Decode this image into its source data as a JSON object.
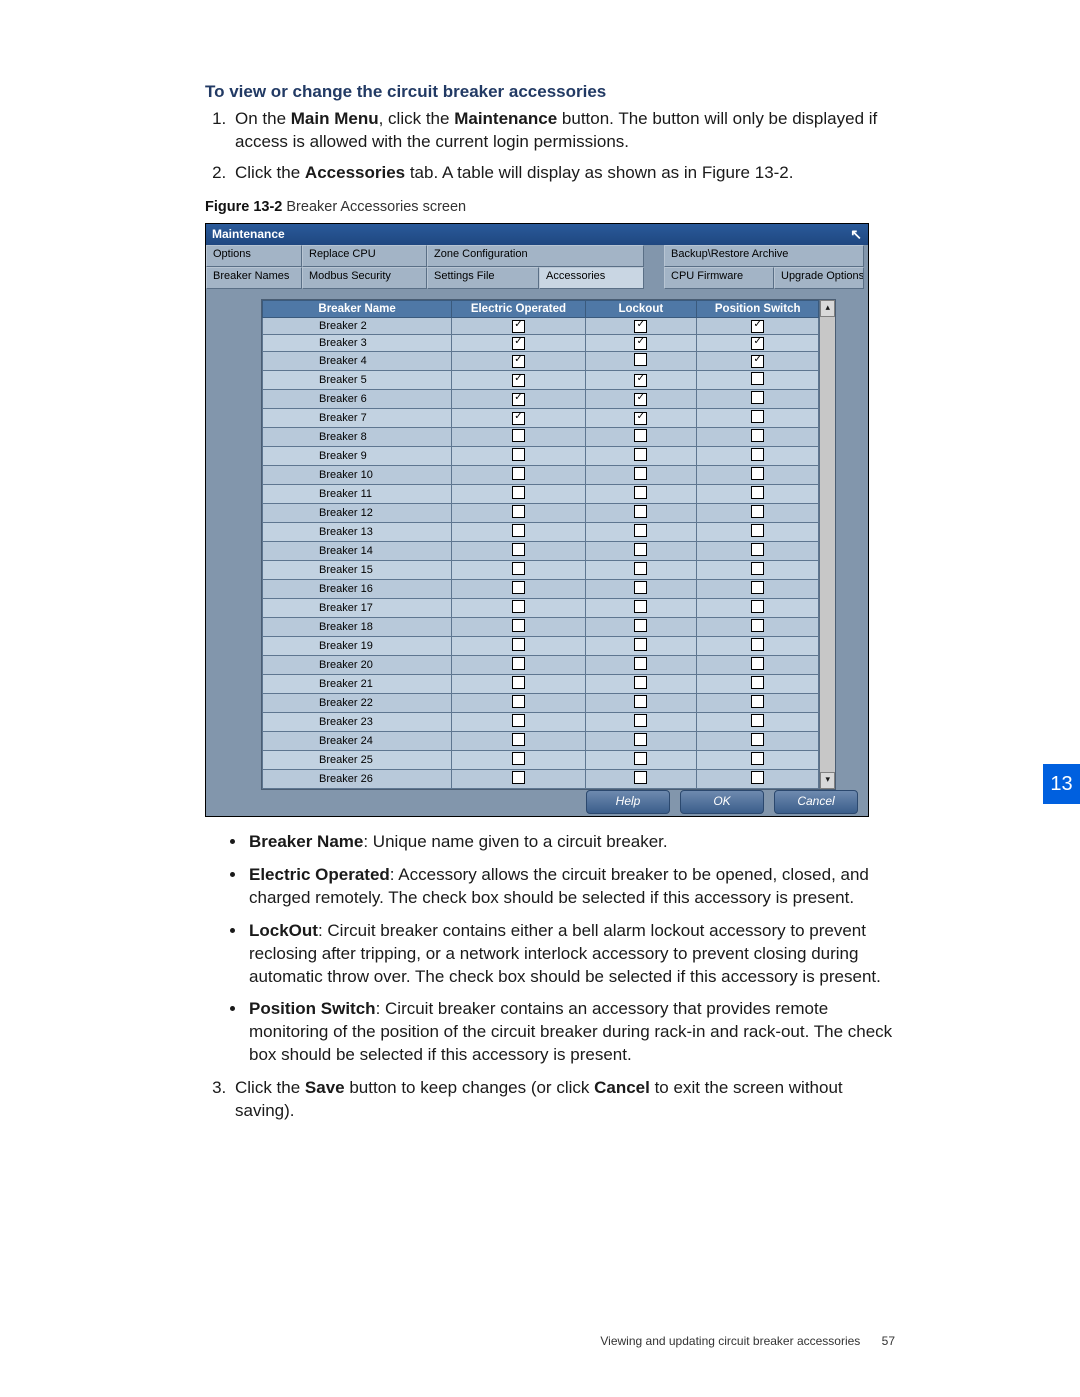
{
  "doc": {
    "heading": "To view or change the circuit breaker accessories",
    "step1_pre": "On the ",
    "step1_b1": "Main Menu",
    "step1_mid": ", click the ",
    "step1_b2": "Maintenance",
    "step1_post": " button. The button will only be displayed if access is allowed with the current login permissions.",
    "step2_pre": "Click the ",
    "step2_b1": "Accessories",
    "step2_post": " tab. A table will display as shown as in Figure 13-2.",
    "fig_label": "Figure 13-2",
    "fig_title": " Breaker Accessories screen",
    "bullet1_b": "Breaker Name",
    "bullet1_t": ": Unique name given to a circuit breaker.",
    "bullet2_b": "Electric Operated",
    "bullet2_t": ": Accessory allows the circuit breaker to be opened, closed, and charged remotely. The check box should be selected if this accessory is present.",
    "bullet3_b": "LockOut",
    "bullet3_t": ": Circuit breaker contains either a bell alarm lockout accessory to prevent reclosing after tripping, or a network interlock accessory to prevent closing during automatic throw over. The check box should be selected if this accessory is present.",
    "bullet4_b": "Position Switch",
    "bullet4_t": ": Circuit breaker contains an accessory that provides remote monitoring of the position of the circuit breaker during rack-in and rack-out. The check box should be selected if this accessory is present.",
    "step3_pre": "Click the ",
    "step3_b1": "Save",
    "step3_mid": " button to keep changes (or click ",
    "step3_b2": "Cancel",
    "step3_post": " to exit the screen without saving).",
    "chapter": "13",
    "footer_text": "Viewing and updating circuit breaker accessories",
    "page_number": "57"
  },
  "window": {
    "title": "Maintenance",
    "tabs_row1": [
      "Options",
      "Replace CPU",
      "Zone Configuration",
      "",
      "Backup\\Restore Archive",
      ""
    ],
    "tabs_row2": [
      "Breaker Names",
      "Modbus Security",
      "Settings File",
      "Accessories",
      "",
      "CPU Firmware",
      "Upgrade Options"
    ],
    "active_tab": "Accessories",
    "headers": [
      "Breaker Name",
      "Electric Operated",
      "Lockout",
      "Position Switch"
    ],
    "rows": [
      {
        "name": "Breaker 2",
        "eo": true,
        "lo": true,
        "ps": true
      },
      {
        "name": "Breaker 3",
        "eo": true,
        "lo": true,
        "ps": true
      },
      {
        "name": "Breaker 4",
        "eo": true,
        "lo": false,
        "ps": true
      },
      {
        "name": "Breaker 5",
        "eo": true,
        "lo": true,
        "ps": false
      },
      {
        "name": "Breaker 6",
        "eo": true,
        "lo": true,
        "ps": false
      },
      {
        "name": "Breaker 7",
        "eo": true,
        "lo": true,
        "ps": false
      },
      {
        "name": "Breaker 8",
        "eo": false,
        "lo": false,
        "ps": false
      },
      {
        "name": "Breaker 9",
        "eo": false,
        "lo": false,
        "ps": false
      },
      {
        "name": "Breaker 10",
        "eo": false,
        "lo": false,
        "ps": false
      },
      {
        "name": "Breaker 11",
        "eo": false,
        "lo": false,
        "ps": false
      },
      {
        "name": "Breaker 12",
        "eo": false,
        "lo": false,
        "ps": false
      },
      {
        "name": "Breaker 13",
        "eo": false,
        "lo": false,
        "ps": false
      },
      {
        "name": "Breaker 14",
        "eo": false,
        "lo": false,
        "ps": false
      },
      {
        "name": "Breaker 15",
        "eo": false,
        "lo": false,
        "ps": false
      },
      {
        "name": "Breaker 16",
        "eo": false,
        "lo": false,
        "ps": false
      },
      {
        "name": "Breaker 17",
        "eo": false,
        "lo": false,
        "ps": false
      },
      {
        "name": "Breaker 18",
        "eo": false,
        "lo": false,
        "ps": false
      },
      {
        "name": "Breaker 19",
        "eo": false,
        "lo": false,
        "ps": false
      },
      {
        "name": "Breaker 20",
        "eo": false,
        "lo": false,
        "ps": false
      },
      {
        "name": "Breaker 21",
        "eo": false,
        "lo": false,
        "ps": false
      },
      {
        "name": "Breaker 22",
        "eo": false,
        "lo": false,
        "ps": false
      },
      {
        "name": "Breaker 23",
        "eo": false,
        "lo": false,
        "ps": false
      },
      {
        "name": "Breaker 24",
        "eo": false,
        "lo": false,
        "ps": false
      },
      {
        "name": "Breaker 25",
        "eo": false,
        "lo": false,
        "ps": false
      },
      {
        "name": "Breaker 26",
        "eo": false,
        "lo": false,
        "ps": false
      }
    ],
    "buttons": {
      "help": "Help",
      "ok": "OK",
      "cancel": "Cancel"
    }
  }
}
